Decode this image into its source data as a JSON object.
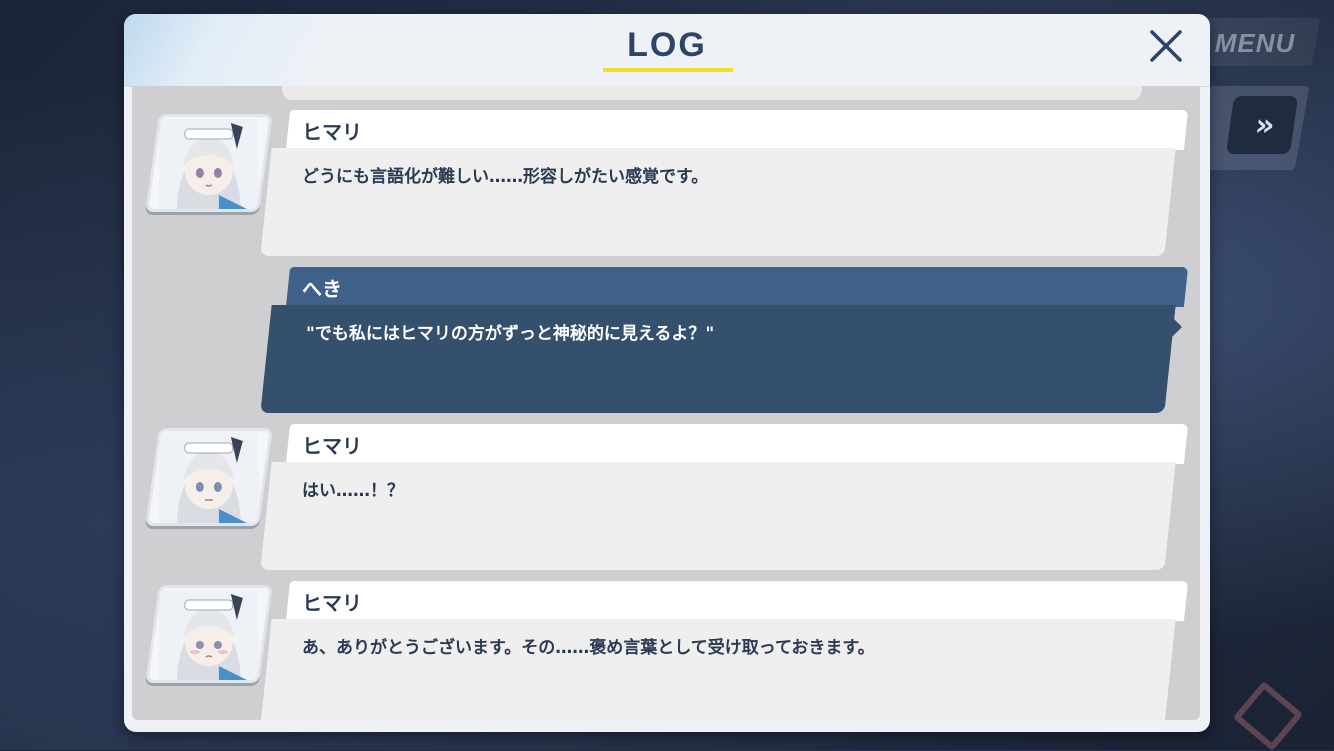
{
  "background": {
    "menu_label": "MENU",
    "skip_label": "»"
  },
  "log": {
    "title": "LOG",
    "close_label": "×",
    "colors": {
      "title": "#2c4466",
      "underline": "#f2df28",
      "player_bubble": "#35506d",
      "npc_bubble": "#efefef"
    },
    "entries": [
      {
        "speaker": "ヒマリ",
        "text": "どうにも言語化が難しい……形容しがたい感覚です。",
        "kind": "npc",
        "avatar": "himari-portrait-icon"
      },
      {
        "speaker": "へき",
        "text": "\"でも私にはヒマリの方がずっと神秘的に見えるよ？\"",
        "kind": "player"
      },
      {
        "speaker": "ヒマリ",
        "text": "はい……！？",
        "kind": "npc",
        "avatar": "himari-portrait-icon"
      },
      {
        "speaker": "ヒマリ",
        "text": "あ、ありがとうございます。その……褒め言葉として受け取っておきます。",
        "kind": "npc",
        "avatar": "himari-portrait-icon"
      }
    ]
  }
}
